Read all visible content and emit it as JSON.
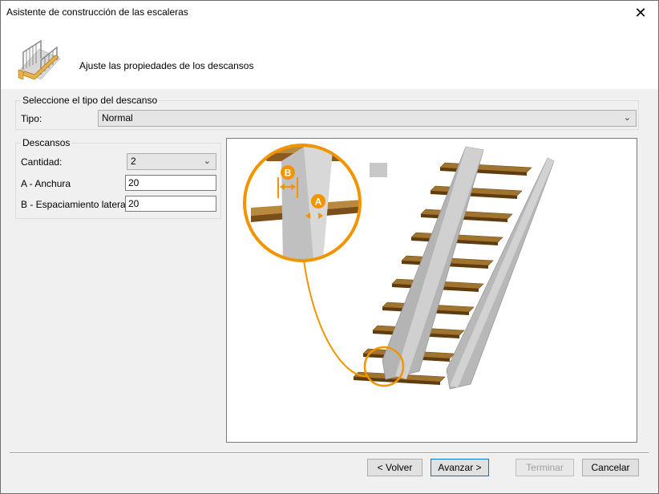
{
  "window": {
    "title": "Asistente de construcción de las escaleras",
    "close_glyph": "✕"
  },
  "header": {
    "instruction": "Ajuste las propiedades de los descansos",
    "icon": "stair-wizard-icon"
  },
  "tipo_group": {
    "legend": "Seleccione el tipo del descanso",
    "label": "Tipo:",
    "value": "Normal"
  },
  "descansos_group": {
    "legend": "Descansos",
    "cantidad_label": "Cantidad:",
    "cantidad_value": "2",
    "anchura_label": "A - Anchura",
    "anchura_value": "20",
    "espaciamiento_label": "B - Espaciamiento lateral:",
    "espaciamiento_value": "20"
  },
  "preview": {
    "marker_a": "A",
    "marker_b": "B",
    "accent_color": "#f29400"
  },
  "buttons": {
    "back": "< Volver",
    "next": "Avanzar >",
    "finish": "Terminar",
    "cancel": "Cancelar"
  }
}
